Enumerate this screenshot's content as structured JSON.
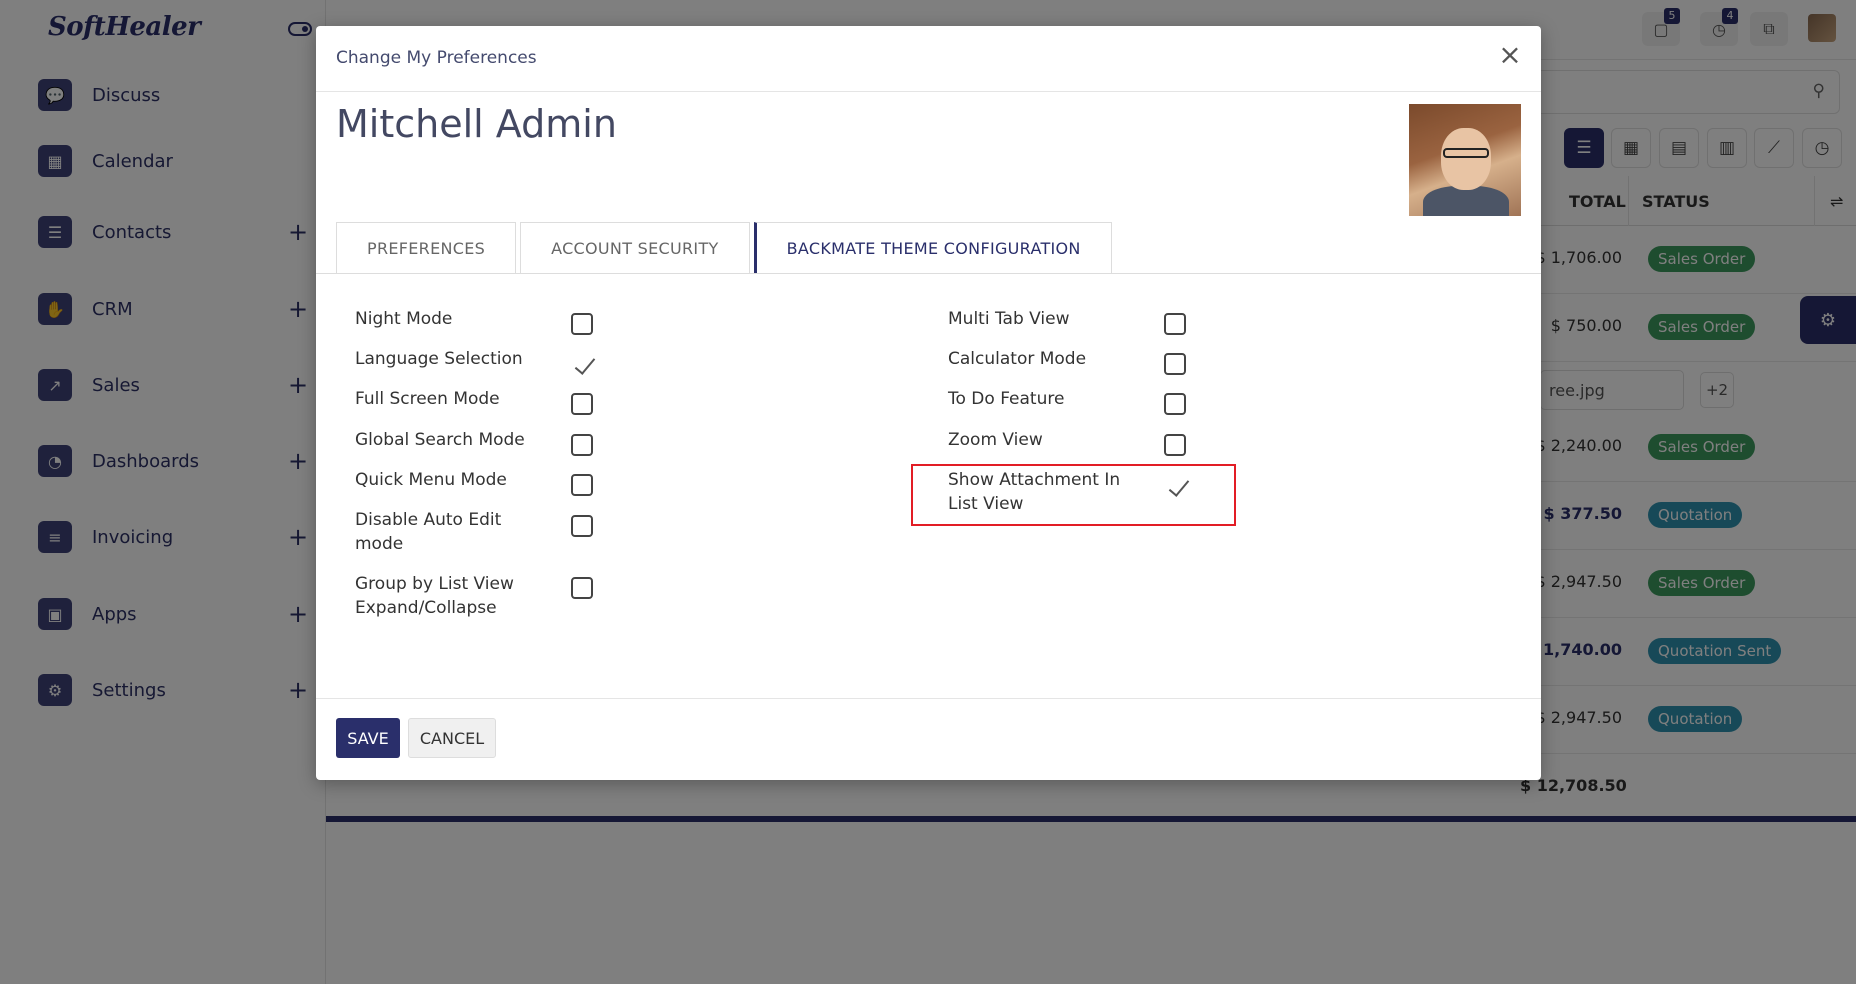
{
  "app": {
    "logo": "SoftHealer",
    "menu": [
      {
        "label": "Discuss",
        "icon": "chat-icon",
        "plus": false
      },
      {
        "label": "Calendar",
        "icon": "calendar-icon",
        "plus": false
      },
      {
        "label": "Contacts",
        "icon": "contacts-icon",
        "plus": true
      },
      {
        "label": "CRM",
        "icon": "handshake-icon",
        "plus": true
      },
      {
        "label": "Sales",
        "icon": "chart-line-icon",
        "plus": true
      },
      {
        "label": "Dashboards",
        "icon": "gauge-icon",
        "plus": true
      },
      {
        "label": "Invoicing",
        "icon": "receipt-icon",
        "plus": true
      },
      {
        "label": "Apps",
        "icon": "cubes-icon",
        "plus": true
      },
      {
        "label": "Settings",
        "icon": "gear-icon",
        "plus": true
      }
    ],
    "plus_sign": "+",
    "topbar": {
      "messages_count": "5",
      "activities_count": "4"
    },
    "list": {
      "headers": [
        "TOTAL",
        "STATUS"
      ],
      "rows": [
        {
          "total": "$ 1,706.00",
          "status": "Sales Order",
          "status_color": "green",
          "bold": false
        },
        {
          "total": "$ 750.00",
          "status": "Sales Order",
          "status_color": "green",
          "bold": false
        },
        {
          "total": "",
          "status": "",
          "status_color": "",
          "bold": false
        },
        {
          "total": "$ 2,240.00",
          "status": "Sales Order",
          "status_color": "green",
          "bold": false
        },
        {
          "total": "$ 377.50",
          "status": "Quotation",
          "status_color": "teal",
          "bold": true
        },
        {
          "total": "$ 2,947.50",
          "status": "Sales Order",
          "status_color": "green",
          "bold": false
        },
        {
          "total": "$ 1,740.00",
          "status": "Quotation Sent",
          "status_color": "teal",
          "bold": true
        },
        {
          "total": "$ 2,947.50",
          "status": "Quotation",
          "status_color": "teal",
          "bold": false
        }
      ],
      "attachment_chip": "ree.jpg",
      "attachment_more": "+2",
      "grand_total": "$ 12,708.50"
    },
    "colors": {
      "primary": "#2a2f6b",
      "badge_green": "#3c9a5f",
      "badge_teal": "#2f93b0",
      "highlight": "#e21d25"
    }
  },
  "modal": {
    "title": "Change My Preferences",
    "close_symbol": "×",
    "user_name": "Mitchell Admin",
    "tabs": [
      {
        "label": "PREFERENCES",
        "active": false
      },
      {
        "label": "ACCOUNT SECURITY",
        "active": false
      },
      {
        "label": "BACKMATE THEME CONFIGURATION",
        "active": true
      }
    ],
    "left_options": [
      {
        "label": "Night Mode",
        "checked": false
      },
      {
        "label": "Language Selection",
        "checked": true
      },
      {
        "label": "Full Screen Mode",
        "checked": false
      },
      {
        "label": "Global Search Mode",
        "checked": false
      },
      {
        "label": "Quick Menu Mode",
        "checked": false
      },
      {
        "label": "Disable Auto Edit mode",
        "checked": false
      },
      {
        "label": "Group by List View Expand/Collapse",
        "checked": false
      }
    ],
    "right_options": [
      {
        "label": "Multi Tab View",
        "checked": false
      },
      {
        "label": "Calculator Mode",
        "checked": false
      },
      {
        "label": "To Do Feature",
        "checked": false
      },
      {
        "label": "Zoom View",
        "checked": false
      },
      {
        "label": "Show Attachment In List View",
        "checked": true,
        "highlighted": true
      }
    ],
    "save_label": "SAVE",
    "cancel_label": "CANCEL"
  }
}
